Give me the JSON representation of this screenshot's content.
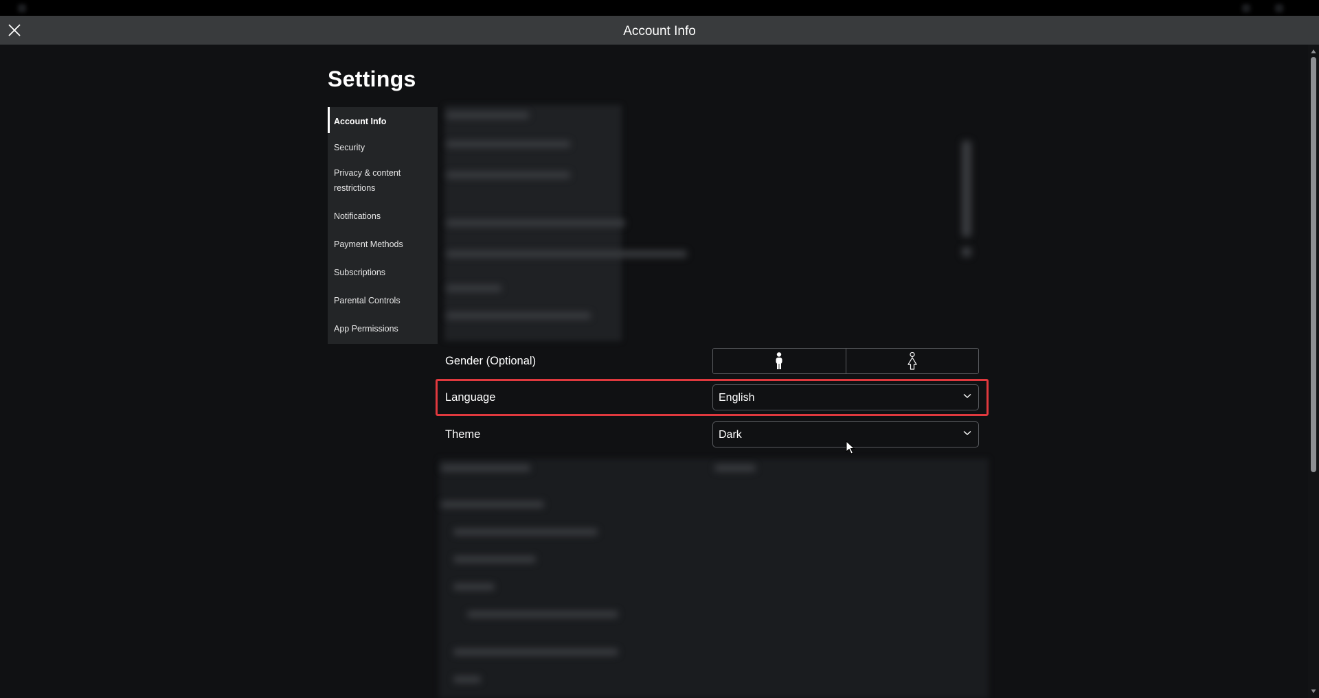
{
  "window": {
    "title": "Account Info"
  },
  "page": {
    "title": "Settings"
  },
  "sidebar": {
    "items": [
      {
        "label": "Account Info",
        "active": true
      },
      {
        "label": "Security",
        "active": false
      },
      {
        "label": "Privacy & content restrictions",
        "active": false
      },
      {
        "label": "Notifications",
        "active": false
      },
      {
        "label": "Payment Methods",
        "active": false
      },
      {
        "label": "Subscriptions",
        "active": false
      },
      {
        "label": "Parental Controls",
        "active": false
      },
      {
        "label": "App Permissions",
        "active": false
      }
    ]
  },
  "settings": {
    "gender": {
      "label": "Gender (Optional)",
      "options": [
        "male-icon",
        "female-icon"
      ]
    },
    "language": {
      "label": "Language",
      "value": "English"
    },
    "theme": {
      "label": "Theme",
      "value": "Dark"
    }
  },
  "colors": {
    "highlight": "#e0393e",
    "titlebar": "#393b3d",
    "sidebar": "#232527",
    "background": "#101113"
  }
}
